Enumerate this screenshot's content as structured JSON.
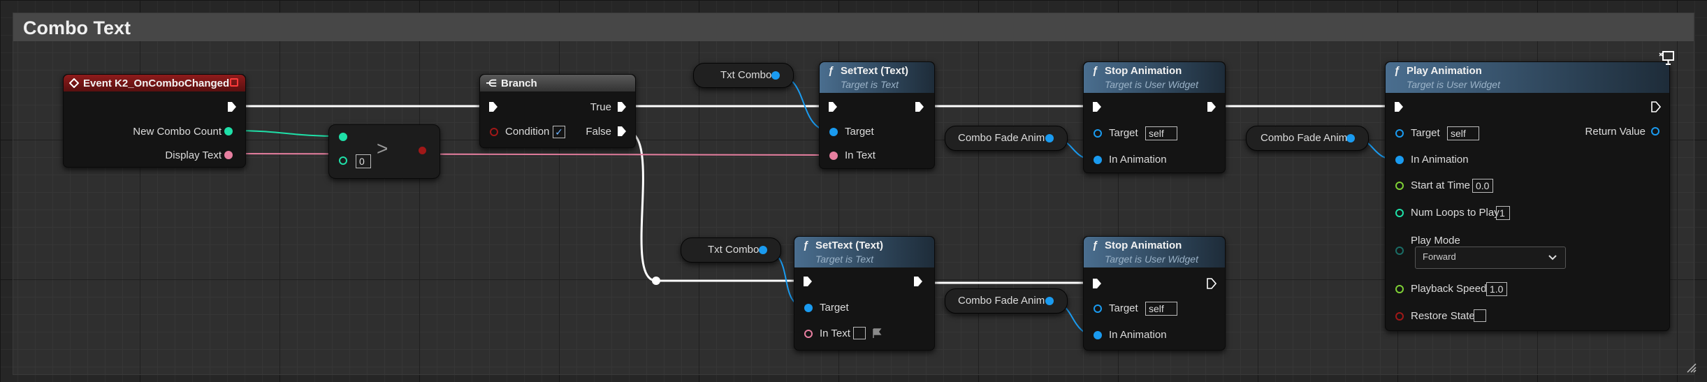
{
  "comment": {
    "title": "Combo Text"
  },
  "event_node": {
    "title": "Event K2_OnComboChanged",
    "pin_new_combo_count": "New Combo Count",
    "pin_display_text": "Display Text"
  },
  "compare_node": {
    "operator": ">",
    "value_b": "0"
  },
  "branch_node": {
    "title": "Branch",
    "pin_condition": "Condition",
    "pin_true": "True",
    "pin_false": "False",
    "condition_checked": "✓"
  },
  "txt_combo_var_1": {
    "label": "Txt Combo"
  },
  "txt_combo_var_2": {
    "label": "Txt Combo"
  },
  "settext_node_1": {
    "title": "SetText (Text)",
    "subtitle": "Target is Text",
    "pin_target": "Target",
    "pin_in_text": "In Text"
  },
  "settext_node_2": {
    "title": "SetText (Text)",
    "subtitle": "Target is Text",
    "pin_target": "Target",
    "pin_in_text": "In Text"
  },
  "combo_fade_var_1": {
    "label": "Combo Fade Anim"
  },
  "combo_fade_var_2": {
    "label": "Combo Fade Anim"
  },
  "combo_fade_var_3": {
    "label": "Combo Fade Anim"
  },
  "stop_anim_node_1": {
    "title": "Stop Animation",
    "subtitle": "Target is User Widget",
    "pin_target": "Target",
    "target_value": "self",
    "pin_in_animation": "In Animation"
  },
  "stop_anim_node_2": {
    "title": "Stop Animation",
    "subtitle": "Target is User Widget",
    "pin_target": "Target",
    "target_value": "self",
    "pin_in_animation": "In Animation"
  },
  "play_anim_node": {
    "title": "Play Animation",
    "subtitle": "Target is User Widget",
    "pin_target": "Target",
    "target_value": "self",
    "pin_return_value": "Return Value",
    "pin_in_animation": "In Animation",
    "pin_start_at_time": "Start at Time",
    "start_at_time_value": "0.0",
    "pin_num_loops": "Num Loops to Play",
    "num_loops_value": "1",
    "pin_play_mode": "Play Mode",
    "play_mode_value": "Forward",
    "pin_playback_speed": "Playback Speed",
    "playback_speed_value": "1.0",
    "pin_restore_state": "Restore State"
  },
  "colors": {
    "exec": "#ffffff",
    "integer": "#1fe0a8",
    "text": "#e77fa0",
    "object": "#1a9bf0",
    "float": "#7ed035",
    "bool": "#a01818",
    "byte": "#1a6d66"
  }
}
